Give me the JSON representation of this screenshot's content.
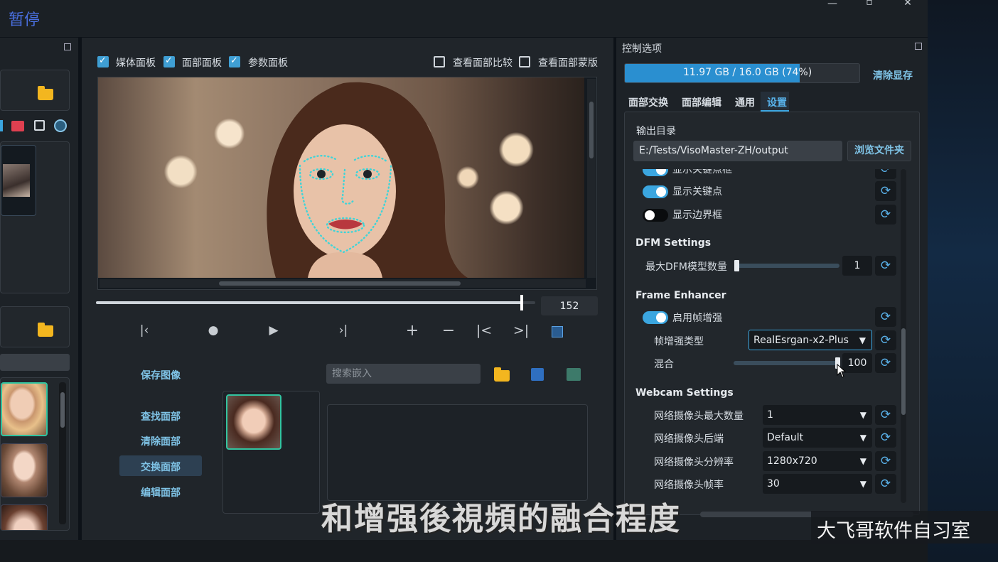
{
  "app": {
    "title": "暂停"
  },
  "center": {
    "checks": [
      {
        "label": "媒体面板",
        "checked": true
      },
      {
        "label": "面部面板",
        "checked": true
      },
      {
        "label": "参数面板",
        "checked": true
      },
      {
        "label": "查看面部比较",
        "checked": false
      },
      {
        "label": "查看面部蒙版",
        "checked": false
      }
    ],
    "frame_value": "152",
    "frame_progress": 0.97,
    "actions": {
      "save_image": "保存图像",
      "find_face": "查找面部",
      "clear_face": "清除面部",
      "swap_face": "交换面部",
      "edit_face": "编辑面部"
    },
    "search_placeholder": "搜索嵌入"
  },
  "right": {
    "title": "控制选项",
    "memory_text": "11.97 GB / 16.0 GB (74%)",
    "memory_fraction": 0.74,
    "clear_memory": "清除显存",
    "tabs": [
      "面部交换",
      "面部编辑",
      "通用",
      "设置"
    ],
    "active_tab": 3,
    "output_dir_label": "输出目录",
    "output_dir_value": "E:/Tests/VisoMaster-ZH/output",
    "browse_button": "浏览文件夹",
    "partial_item": "显示关键点框",
    "show_keypoints": {
      "label": "显示关键点",
      "on": true
    },
    "show_bbox": {
      "label": "显示边界框",
      "on": false
    },
    "dfm": {
      "title": "DFM Settings",
      "max_models_label": "最大DFM模型数量",
      "max_models_value": "1"
    },
    "enhancer": {
      "title": "Frame Enhancer",
      "enable_label": "启用帧增强",
      "enable_on": true,
      "type_label": "帧增强类型",
      "type_value": "RealEsrgan-x2-Plus",
      "blend_label": "混合",
      "blend_value": "100"
    },
    "webcam": {
      "title": "Webcam Settings",
      "rows": [
        {
          "label": "网络摄像头最大数量",
          "value": "1"
        },
        {
          "label": "网络摄像头后端",
          "value": "Default"
        },
        {
          "label": "网络摄像头分辨率",
          "value": "1280x720"
        },
        {
          "label": "网络摄像头帧率",
          "value": "30"
        }
      ]
    }
  },
  "overlay": {
    "subtitle": "和增强後視頻的融合程度",
    "watermark": "大飞哥软件自习室"
  },
  "colors": {
    "accent": "#3ba6e0",
    "memory_bar": "#2a8fd0",
    "panel": "#1d2227"
  }
}
